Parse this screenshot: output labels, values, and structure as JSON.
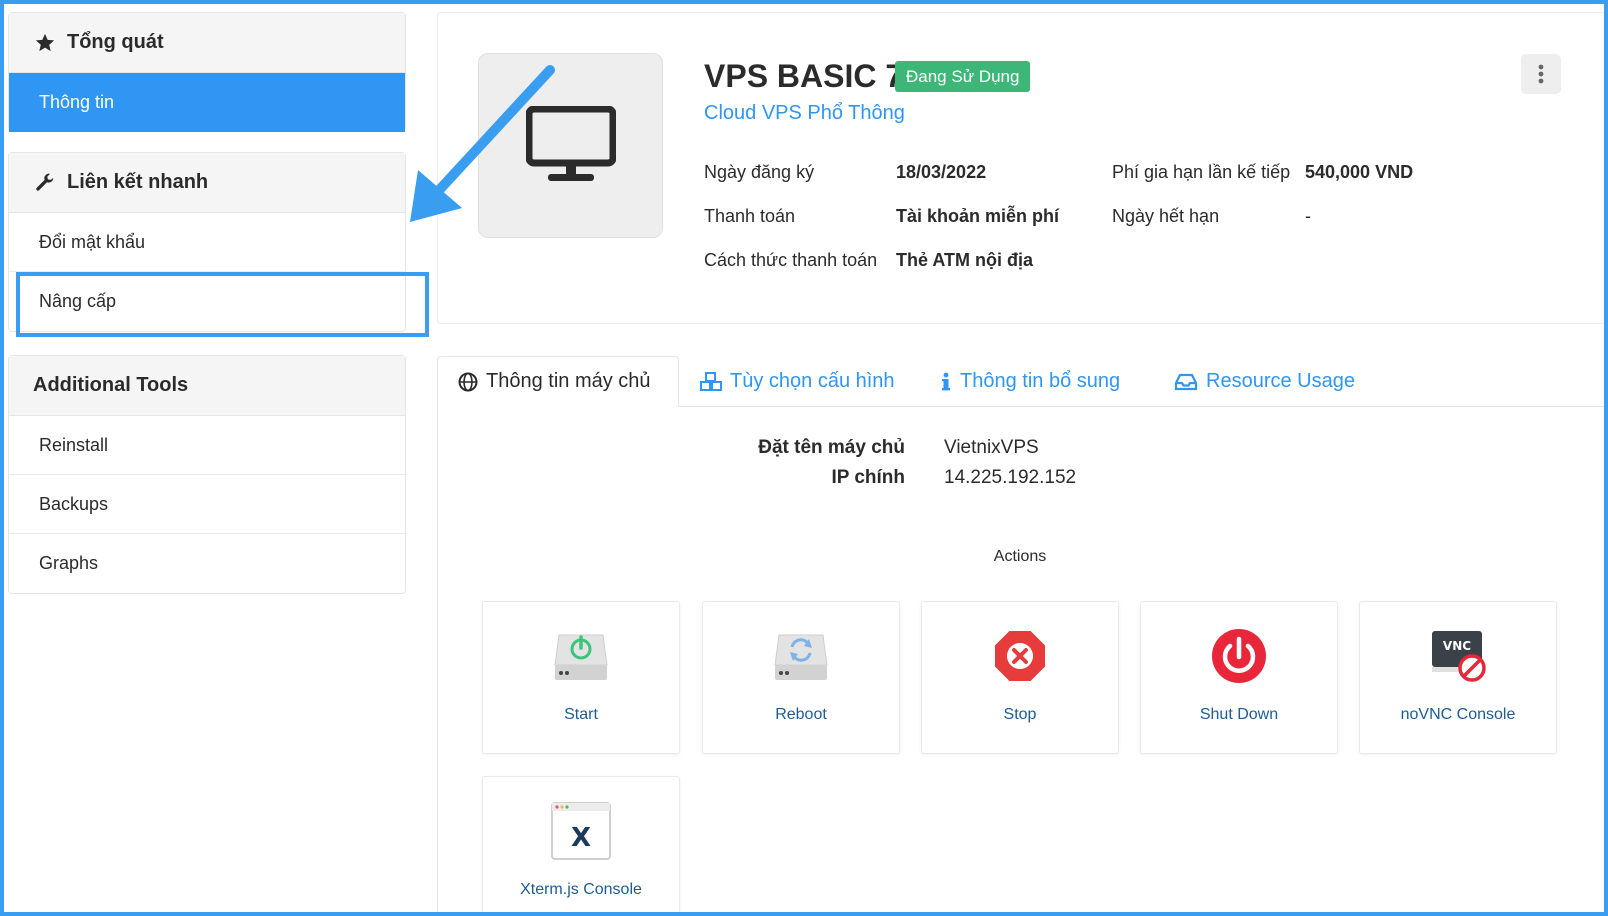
{
  "sidebar": {
    "overview": {
      "title": "Tổng quát",
      "items": [
        {
          "label": "Thông tin",
          "active": true
        }
      ]
    },
    "quick_links": {
      "title": "Liên kết nhanh",
      "items": [
        {
          "label": "Đổi mật khẩu"
        },
        {
          "label": "Nâng cấp"
        }
      ]
    },
    "tools": {
      "title": "Additional Tools",
      "items": [
        {
          "label": "Reinstall"
        },
        {
          "label": "Backups"
        },
        {
          "label": "Graphs"
        }
      ]
    }
  },
  "product": {
    "name": "VPS BASIC 7",
    "status": "Đang Sử Dụng",
    "group": "Cloud VPS Phổ Thông",
    "details": [
      {
        "label": "Ngày đăng ký",
        "value": "18/03/2022"
      },
      {
        "label": "Thanh toán",
        "value": "Tài khoản miễn phí"
      },
      {
        "label": "Cách thức thanh toán",
        "value": "Thẻ ATM nội địa"
      },
      {
        "label": "Phí gia hạn lần kế tiếp",
        "value": "540,000 VND"
      },
      {
        "label": "Ngày hết hạn",
        "value": "-"
      }
    ]
  },
  "tabs": [
    {
      "label": "Thông tin máy chủ",
      "icon": "globe-icon",
      "active": true
    },
    {
      "label": "Tùy chọn cấu hình",
      "icon": "cubes-icon"
    },
    {
      "label": "Thông tin bổ sung",
      "icon": "info-icon"
    },
    {
      "label": "Resource Usage",
      "icon": "inbox-icon"
    }
  ],
  "server": {
    "hostname_label": "Đặt tên máy chủ",
    "hostname": "VietnixVPS",
    "ip_label": "IP chính",
    "ip": "14.225.192.152"
  },
  "actions": {
    "title": "Actions",
    "items": [
      {
        "label": "Start",
        "icon": "drive-power-icon"
      },
      {
        "label": "Reboot",
        "icon": "drive-refresh-icon"
      },
      {
        "label": "Stop",
        "icon": "stop-octagon-icon"
      },
      {
        "label": "Shut Down",
        "icon": "power-button-icon"
      },
      {
        "label": "noVNC Console",
        "icon": "vnc-disabled-icon",
        "icon_text": "VNC"
      },
      {
        "label": "Xterm.js Console",
        "icon": "xterm-window-icon",
        "icon_text": "X"
      }
    ]
  },
  "colors": {
    "accent": "#2f96f3",
    "status": "#3cb777",
    "highlight": "#3a9ef0",
    "link": "#1d5c96"
  }
}
